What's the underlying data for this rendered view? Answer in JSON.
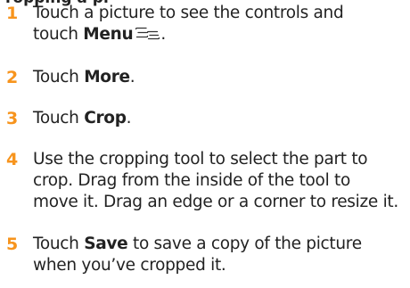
{
  "heading_fragment": "ropping a pi",
  "steps": [
    {
      "number": "1",
      "line1": "Touch a picture to see the controls and",
      "line2_prefix": "touch ",
      "line2_bold": "Menu",
      "line2_suffix": ".",
      "icon": "menu-icon"
    },
    {
      "number": "2",
      "prefix": "Touch ",
      "bold": "More",
      "suffix": "."
    },
    {
      "number": "3",
      "prefix": "Touch ",
      "bold": "Crop",
      "suffix": "."
    },
    {
      "number": "4",
      "lines": [
        "Use the cropping tool to select the part to",
        "crop. Drag from the inside of the tool to",
        "move it. Drag an edge or a corner to resize it."
      ]
    },
    {
      "number": "5",
      "prefix": "Touch ",
      "bold": "Save",
      "line1_suffix": " to save a copy of the picture",
      "line2": "when you’ve cropped it."
    }
  ],
  "colors": {
    "step_number": "#f7941d",
    "text": "#222222"
  }
}
